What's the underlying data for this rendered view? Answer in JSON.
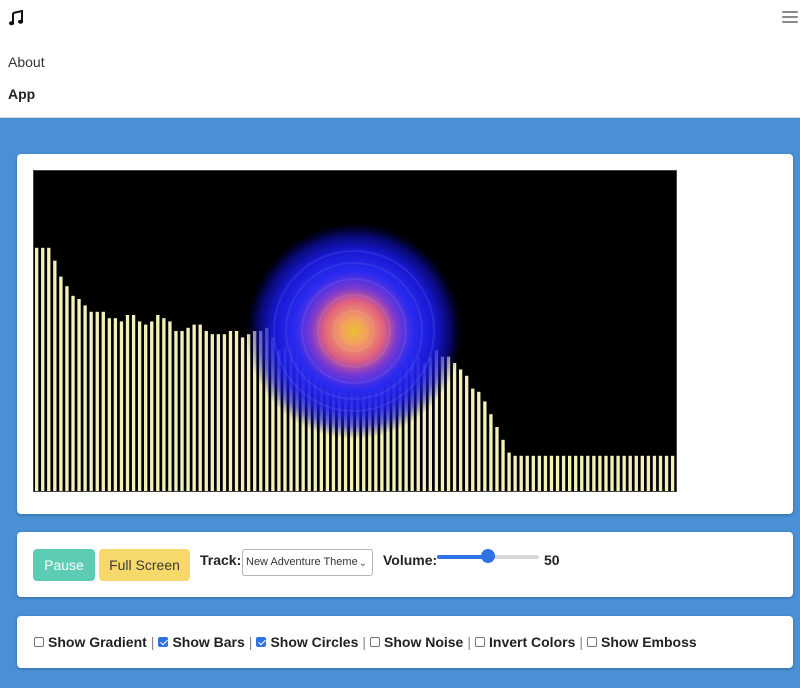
{
  "header": {
    "logo_icon": "music-note-icon",
    "menu_icon": "hamburger-menu-icon",
    "nav": [
      {
        "label": "About"
      },
      {
        "label": "App"
      }
    ]
  },
  "controls": {
    "pause_label": "Pause",
    "fullscreen_label": "Full Screen",
    "track_label": "Track:",
    "track_value": "New Adventure Theme",
    "volume_label": "Volume:",
    "volume_value": "50",
    "volume_fraction": 0.5
  },
  "options": [
    {
      "label": "Show Gradient",
      "checked": false
    },
    {
      "label": "Show Bars",
      "checked": true
    },
    {
      "label": "Show Circles",
      "checked": true
    },
    {
      "label": "Show Noise",
      "checked": false
    },
    {
      "label": "Invert Colors",
      "checked": false
    },
    {
      "label": "Show Emboss",
      "checked": false
    }
  ],
  "colors": {
    "accent": "#4a90d4",
    "pause": "#5ccdb4",
    "fullscreen": "#f7d86a",
    "bars": "#f4f1b8",
    "visualizer_bg": "#000000"
  },
  "visualizer": {
    "bar_levels": [
      0.76,
      0.76,
      0.76,
      0.72,
      0.67,
      0.64,
      0.61,
      0.6,
      0.58,
      0.56,
      0.56,
      0.56,
      0.54,
      0.54,
      0.53,
      0.55,
      0.55,
      0.53,
      0.52,
      0.53,
      0.55,
      0.54,
      0.53,
      0.5,
      0.5,
      0.51,
      0.52,
      0.52,
      0.5,
      0.49,
      0.49,
      0.49,
      0.5,
      0.5,
      0.48,
      0.49,
      0.5,
      0.5,
      0.51,
      0.48,
      0.44,
      0.45,
      0.47,
      0.46,
      0.48,
      0.47,
      0.46,
      0.45,
      0.42,
      0.43,
      0.44,
      0.43,
      0.43,
      0.45,
      0.46,
      0.43,
      0.41,
      0.4,
      0.41,
      0.42,
      0.41,
      0.41,
      0.43,
      0.42,
      0.4,
      0.42,
      0.44,
      0.42,
      0.42,
      0.4,
      0.38,
      0.36,
      0.32,
      0.31,
      0.28,
      0.24,
      0.2,
      0.16,
      0.12,
      0.11,
      0.11,
      0.11,
      0.11,
      0.11,
      0.11,
      0.11,
      0.11,
      0.11,
      0.11,
      0.11,
      0.11,
      0.11,
      0.11,
      0.11,
      0.11,
      0.11,
      0.11,
      0.11,
      0.11,
      0.11,
      0.11,
      0.11,
      0.11,
      0.11,
      0.11,
      0.11
    ]
  }
}
